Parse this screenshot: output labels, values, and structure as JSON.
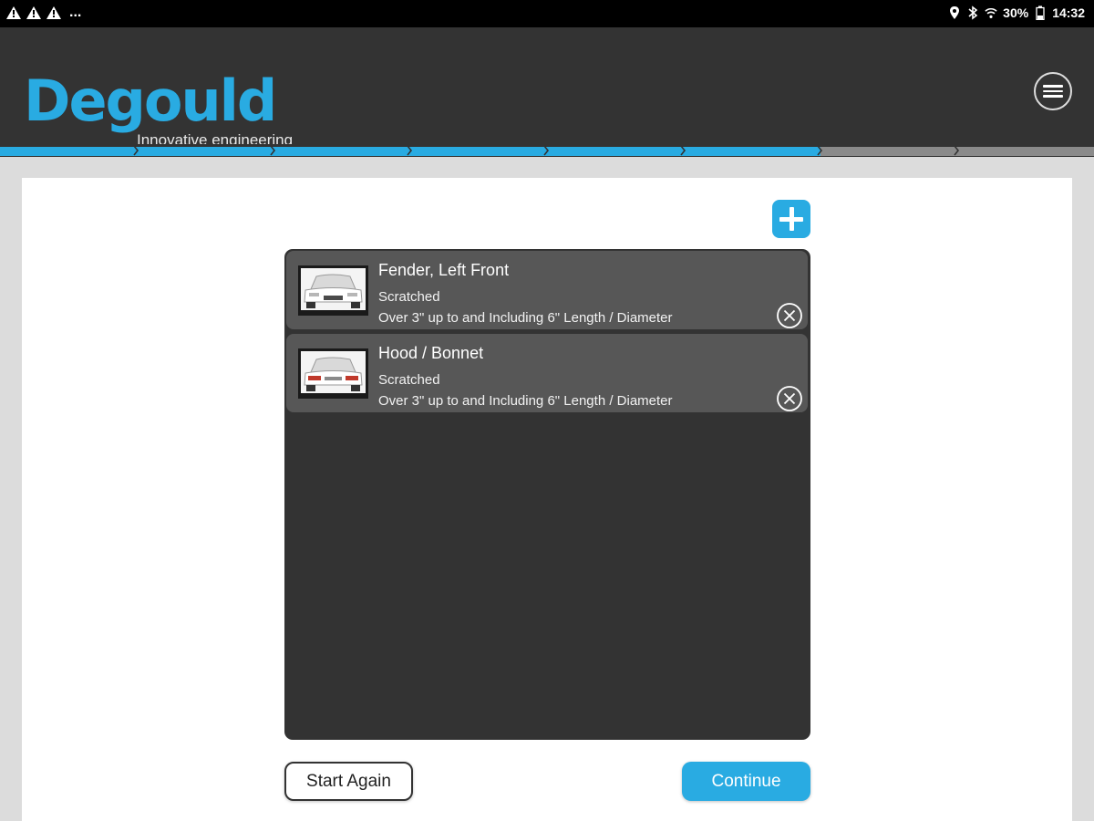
{
  "status_bar": {
    "left_icons": [
      "warning-icon",
      "warning-icon",
      "warning-icon"
    ],
    "overflow": "...",
    "battery": "30%",
    "time": "14:32"
  },
  "header": {
    "logo": "Degould",
    "tagline": "Innovative engineering"
  },
  "progress": {
    "total_steps": 8,
    "completed_steps": 6,
    "active_color": "#29abe2",
    "inactive_color": "#8a8a8a"
  },
  "damage_list": [
    {
      "title": "Fender, Left Front",
      "damage_type": "Scratched",
      "size": "Over 3\" up to and Including 6\" Length / Diameter"
    },
    {
      "title": "Hood / Bonnet",
      "damage_type": "Scratched",
      "size": "Over 3\" up to and Including 6\" Length / Diameter"
    }
  ],
  "buttons": {
    "start_again": "Start Again",
    "continue": "Continue"
  },
  "colors": {
    "brand_blue": "#29abe2",
    "header_bg": "#333333",
    "list_bg": "#333333",
    "item_bg": "#575757"
  }
}
